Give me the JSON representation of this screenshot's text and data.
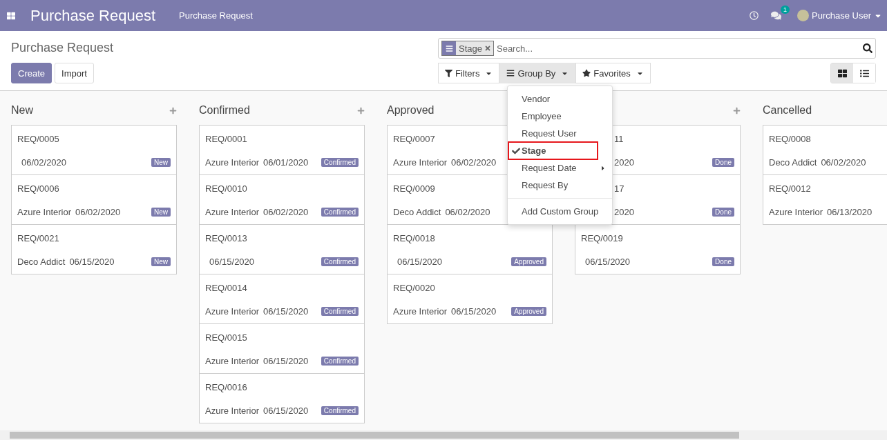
{
  "navbar": {
    "brand": "Purchase Request",
    "menu": [
      "Purchase Request"
    ],
    "messages_count": "1",
    "user": "Purchase User"
  },
  "control_panel": {
    "title": "Purchase Request",
    "buttons": [
      {
        "label": "Create",
        "kind": "primary"
      },
      {
        "label": "Import",
        "kind": "secondary"
      }
    ],
    "search": {
      "facets": [
        {
          "label": "Stage"
        }
      ],
      "placeholder": "Search..."
    },
    "search_options": [
      {
        "label": "Filters",
        "kind": "filter",
        "selected": false
      },
      {
        "label": "Group By",
        "kind": "group",
        "selected": true
      },
      {
        "label": "Favorites",
        "kind": "star",
        "selected": false
      }
    ],
    "views": [
      {
        "kind": "kanban",
        "selected": true
      },
      {
        "kind": "list",
        "selected": false
      }
    ]
  },
  "group_by_menu": {
    "items": [
      {
        "label": "Vendor",
        "checked": false,
        "highlighted": false,
        "submenu": false
      },
      {
        "label": "Employee",
        "checked": false,
        "highlighted": false,
        "submenu": false
      },
      {
        "label": "Request User",
        "checked": false,
        "highlighted": false,
        "submenu": false
      },
      {
        "label": "Stage",
        "checked": true,
        "highlighted": true,
        "submenu": false
      },
      {
        "label": "Request Date",
        "checked": false,
        "highlighted": false,
        "submenu": true
      },
      {
        "label": "Request By",
        "checked": false,
        "highlighted": false,
        "submenu": false
      }
    ],
    "custom": "Add Custom Group"
  },
  "columns": [
    {
      "title": "New",
      "add_button": true,
      "cards": [
        {
          "kind": "full",
          "ref": "REQ/0005",
          "date": "06/02/2020",
          "status": "New"
        },
        {
          "kind": "full",
          "ref": "REQ/0006",
          "vendor": "Azure Interior",
          "date": "06/02/2020",
          "status": "New"
        },
        {
          "kind": "full",
          "ref": "REQ/0021",
          "vendor": "Deco Addict",
          "date": "06/15/2020",
          "status": "New"
        }
      ]
    },
    {
      "title": "Confirmed",
      "add_button": true,
      "cards": [
        {
          "kind": "full",
          "ref": "REQ/0001",
          "vendor": "Azure Interior",
          "date": "06/01/2020",
          "status": "Confirmed"
        },
        {
          "kind": "full",
          "ref": "REQ/0010",
          "vendor": "Azure Interior",
          "date": "06/02/2020",
          "status": "Confirmed"
        },
        {
          "kind": "full",
          "ref": "REQ/0013",
          "date": "06/15/2020",
          "status": "Confirmed"
        },
        {
          "kind": "full",
          "ref": "REQ/0014",
          "vendor": "Azure Interior",
          "date": "06/15/2020",
          "status": "Confirmed"
        },
        {
          "kind": "full",
          "ref": "REQ/0015",
          "vendor": "Azure Interior",
          "date": "06/15/2020",
          "status": "Confirmed"
        },
        {
          "kind": "full",
          "ref": "REQ/0016",
          "vendor": "Azure Interior",
          "date": "06/15/2020",
          "status": "Confirmed"
        }
      ]
    },
    {
      "title": "Approved",
      "add_button": false,
      "cards": [
        {
          "kind": "full",
          "ref": "REQ/0007",
          "vendor": "Azure Interior",
          "date": "06/02/2020"
        },
        {
          "kind": "full",
          "ref": "REQ/0009",
          "vendor": "Deco Addict",
          "date": "06/02/2020"
        },
        {
          "kind": "full",
          "ref": "REQ/0018",
          "date": "06/15/2020",
          "status": "Approved"
        },
        {
          "kind": "full",
          "ref": "REQ/0020",
          "vendor": "Azure Interior",
          "date": "06/15/2020",
          "status": "Approved"
        }
      ]
    },
    {
      "add_button": true,
      "cards": [
        {
          "kind": "clipped",
          "ref": "11",
          "date": "2020",
          "status": "Done"
        },
        {
          "kind": "clipped",
          "ref": "17",
          "date": "2020",
          "status": "Done"
        },
        {
          "kind": "full",
          "ref": "REQ/0019",
          "date": "06/15/2020",
          "status": "Done"
        }
      ]
    },
    {
      "title": "Cancelled",
      "add_button": false,
      "cards": [
        {
          "kind": "full",
          "ref": "REQ/0008",
          "vendor": "Deco Addict",
          "date": "06/02/2020"
        },
        {
          "kind": "full",
          "ref": "REQ/0012",
          "vendor": "Azure Interior",
          "date": "06/13/2020"
        }
      ]
    }
  ]
}
